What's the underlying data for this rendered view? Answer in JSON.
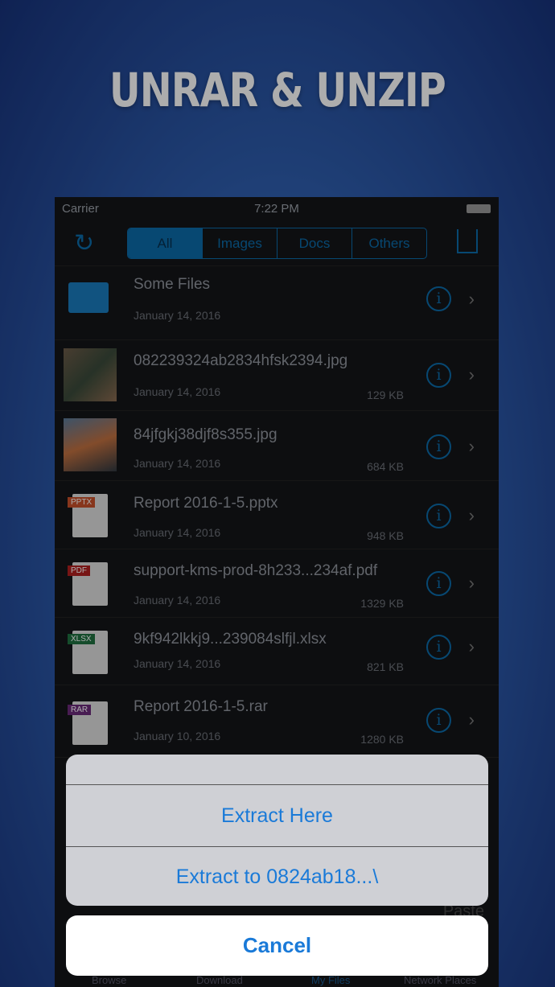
{
  "headline": "UNRAR & UNZIP",
  "status": {
    "carrier": "Carrier",
    "time": "7:22 PM"
  },
  "segments": [
    "All",
    "Images",
    "Docs",
    "Others"
  ],
  "files": [
    {
      "name": "Some Files",
      "date": "January 14, 2016",
      "size": "",
      "type": "folder"
    },
    {
      "name": "082239324ab2834hfsk2394.jpg",
      "date": "January 14, 2016",
      "size": "129 KB",
      "type": "image"
    },
    {
      "name": "84jfgkj38djf8s355.jpg",
      "date": "January 14, 2016",
      "size": "684 KB",
      "type": "image"
    },
    {
      "name": "Report 2016-1-5.pptx",
      "date": "January 14, 2016",
      "size": "948 KB",
      "type": "PPTX"
    },
    {
      "name": "support-kms-prod-8h233...234af.pdf",
      "date": "January 14, 2016",
      "size": "1329 KB",
      "type": "PDF"
    },
    {
      "name": "9kf942lkkj9...239084slfjl.xlsx",
      "date": "January 14, 2016",
      "size": "821 KB",
      "type": "XLSX"
    },
    {
      "name": "Report 2016-1-5.rar",
      "date": "January 10, 2016",
      "size": "1280 KB",
      "type": "RAR"
    }
  ],
  "toolbar": {
    "paste": "Paste"
  },
  "tabs": [
    "Browse",
    "Download",
    "My Files",
    "Network Places"
  ],
  "sheet": {
    "extract_here": "Extract Here",
    "extract_to": "Extract to 0824ab18...\\",
    "cancel": "Cancel"
  },
  "colors": {
    "accent": "#0b6aa8",
    "action": "#1a7ad8"
  }
}
